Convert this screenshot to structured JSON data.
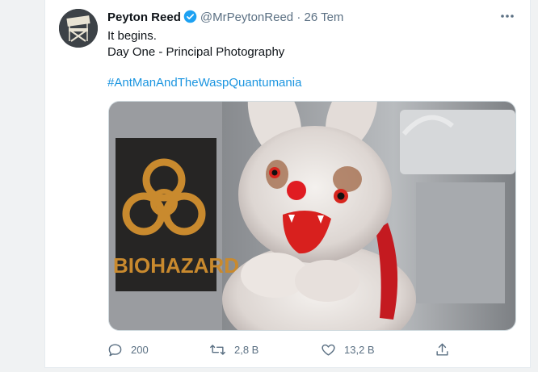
{
  "tweet": {
    "author_name": "Peyton Reed",
    "author_handle": "@MrPeytonReed",
    "separator": "·",
    "date": "26 Tem",
    "text": "It begins.\nDay One - Principal Photography",
    "hashtag": "#AntManAndTheWaspQuantumania",
    "image_text": "BIOHAZARD",
    "actions": {
      "reply_count": "200",
      "retweet_count": "2,8 B",
      "like_count": "13,2 B"
    }
  },
  "icons": {
    "verified": "verified-badge-icon",
    "more": "more-options-icon",
    "reply": "reply-icon",
    "retweet": "retweet-icon",
    "like": "heart-icon",
    "share": "share-icon"
  },
  "colors": {
    "link": "#1b95e0",
    "secondary_text": "#5b7083",
    "verified": "#1da1f2",
    "background": "#f0f2f3"
  }
}
